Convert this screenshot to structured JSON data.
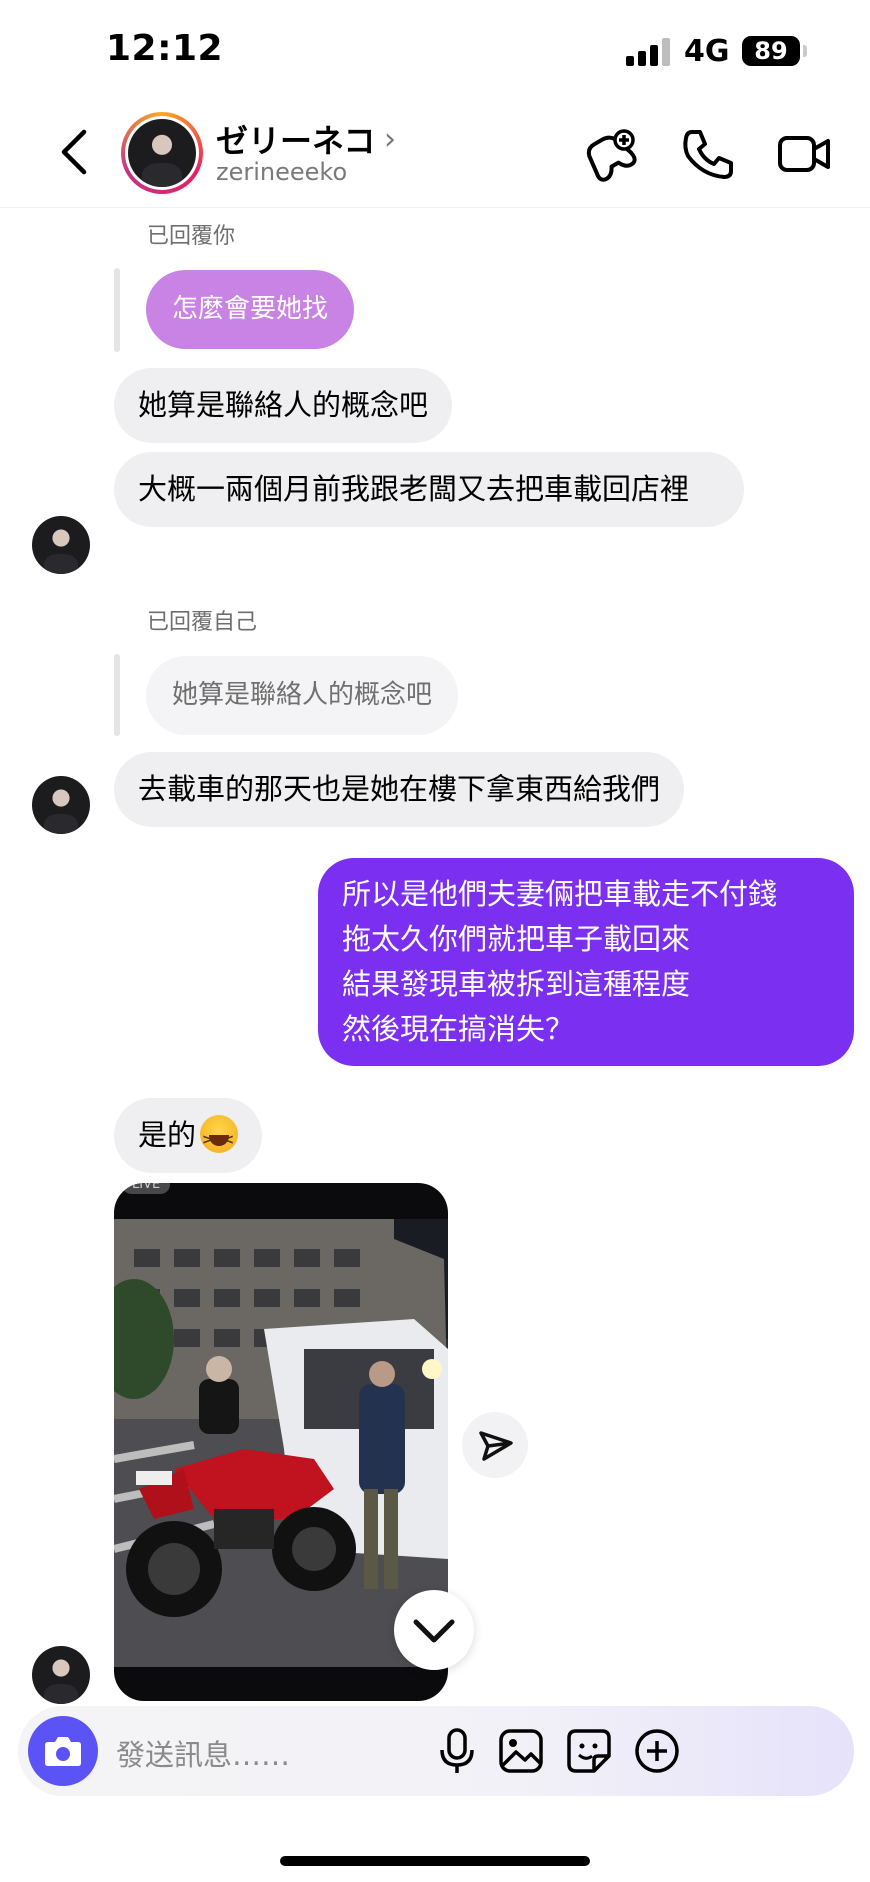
{
  "status_bar": {
    "time": "12:12",
    "network": "4G",
    "battery": "89"
  },
  "header": {
    "name": "ゼリーネコ",
    "handle": "zerineeeko"
  },
  "messages": {
    "reply1_label": "已回覆你",
    "reply1_quote": "怎麼會要她找",
    "msg1": "她算是聯絡人的概念吧",
    "msg2": "大概一兩個月前我跟老闆又去把車載回店裡",
    "reply2_label": "已回覆自己",
    "reply2_quote": "她算是聯絡人的概念吧",
    "msg3": "去載車的那天也是她在樓下拿東西給我們",
    "out_lines": [
      "所以是他們夫妻倆把車載走不付錢",
      "拖太久你們就把車子載回來",
      "結果發現車被拆到這種程度",
      "然後現在搞消失？"
    ],
    "msg4": "是的",
    "photo_live": "LIVE"
  },
  "composer": {
    "placeholder": "發送訊息……"
  },
  "colors": {
    "outgoing": "#7b2ff0",
    "quote_purple": "#c77de3",
    "camera": "#5b53f5"
  },
  "icons": [
    "back-icon",
    "games-icon",
    "phone-icon",
    "video-icon",
    "share-icon",
    "chevron-down-icon",
    "camera-icon",
    "mic-icon",
    "image-icon",
    "sticker-icon",
    "plus-icon"
  ]
}
